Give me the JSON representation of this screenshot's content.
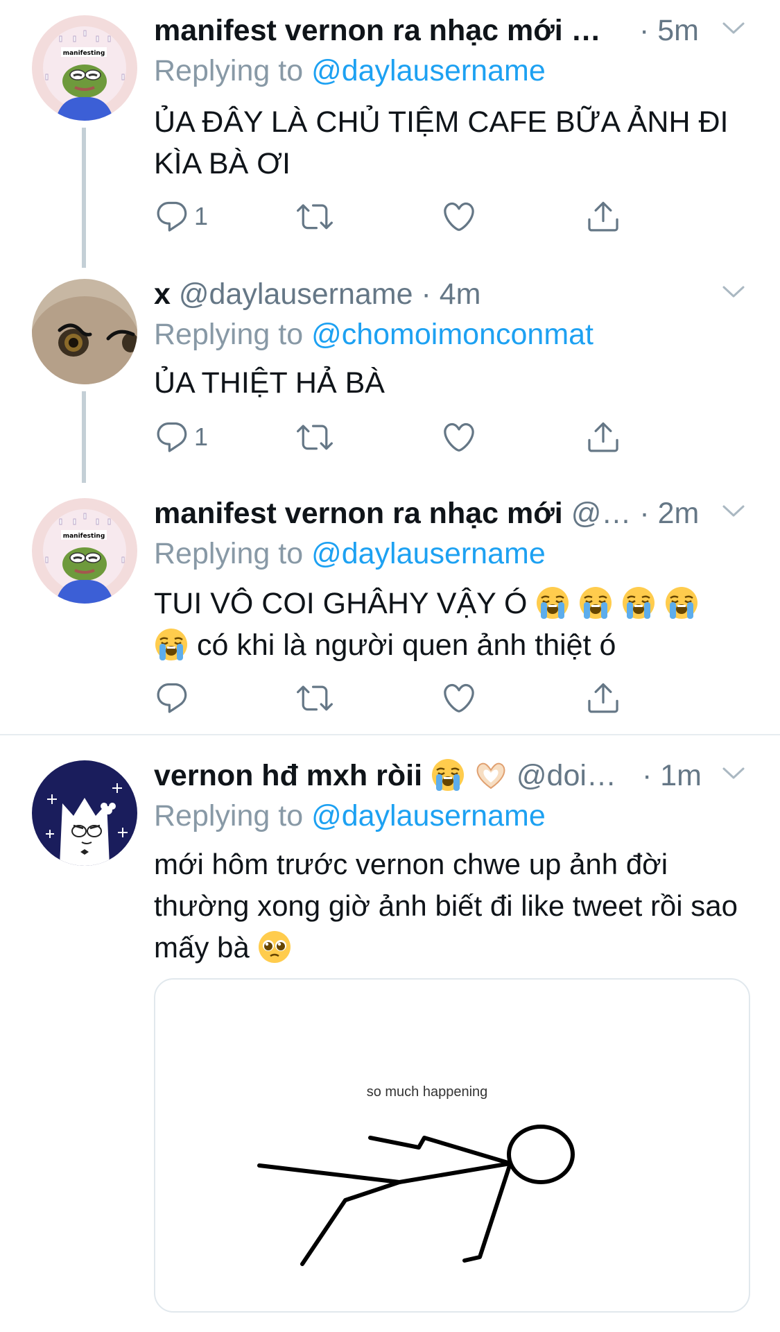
{
  "tweets": [
    {
      "name": "manifest vernon ra nhạc mới …",
      "handle": "",
      "time": "· 5m",
      "replying_prefix": "Replying to ",
      "replying_to": "@daylausername",
      "text": "ỦA ĐÂY LÀ CHỦ TIỆM CAFE BỮA ẢNH ĐI KÌA BÀ ƠI",
      "reply_count": "1",
      "avatar_label": "manifesting"
    },
    {
      "name": "x",
      "handle": "@daylausername",
      "time": "· 4m",
      "replying_prefix": "Replying to ",
      "replying_to": "@chomoimonconmat",
      "text": "ỦA THIỆT HẢ BÀ",
      "reply_count": "1"
    },
    {
      "name": "manifest vernon ra nhạc mới",
      "handle": "@…",
      "time": "· 2m",
      "replying_prefix": "Replying to ",
      "replying_to": "@daylausername",
      "text_line1": "TUI VÔ COI GHÂHY VẬY Ó",
      "text_line2": "có khi là người quen ảnh thiệt ó",
      "reply_count": "",
      "avatar_label": "manifesting"
    },
    {
      "name": "vernon hđ mxh ròii",
      "handle": "@doi…",
      "time": "· 1m",
      "replying_prefix": "Replying to ",
      "replying_to": "@daylausername",
      "text": "mới hôm trước vernon chwe up ảnh đời thường xong giờ ảnh biết đi like tweet rồi sao mấy bà",
      "media_caption": "so much happening"
    }
  ],
  "icons": {
    "reply": "reply-icon",
    "retweet": "retweet-icon",
    "like": "heart-icon",
    "share": "share-icon",
    "more": "chevron-down-icon",
    "crying": "loudly-crying-face-emoji",
    "heart_hands": "heart-hands-emoji",
    "pleading": "pleading-face-emoji"
  },
  "colors": {
    "link": "#1da1f2",
    "muted": "#657786",
    "reply_text": "#8899a6",
    "thread_line": "#c4cfd6"
  }
}
